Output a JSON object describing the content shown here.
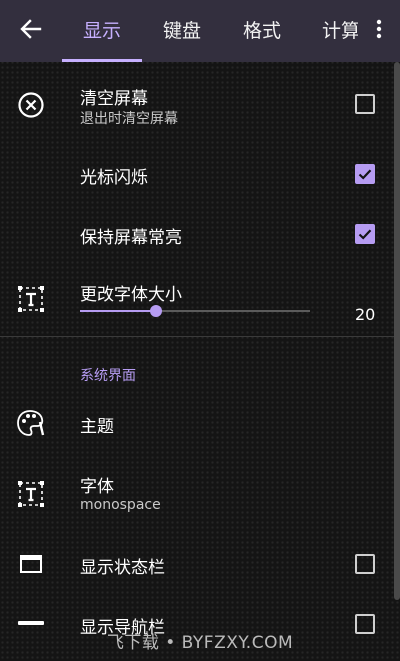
{
  "header": {
    "back_icon": "arrow-left-icon",
    "tabs": [
      {
        "label": "显示",
        "active": true
      },
      {
        "label": "键盘",
        "active": false
      },
      {
        "label": "格式",
        "active": false
      },
      {
        "label": "计算",
        "active": false
      }
    ],
    "overflow_icon": "more-vert-icon"
  },
  "settings": {
    "clear_screen": {
      "title": "清空屏幕",
      "subtitle": "退出时清空屏幕",
      "checked": false,
      "icon": "clear-circle-icon"
    },
    "cursor_blink": {
      "title": "光标闪烁",
      "checked": true
    },
    "keep_screen_on": {
      "title": "保持屏幕常亮",
      "checked": true
    },
    "font_size": {
      "title": "更改字体大小",
      "value": "20",
      "fraction": 0.33,
      "icon": "text-size-icon"
    }
  },
  "ui_section": {
    "title": "系统界面",
    "theme": {
      "title": "主题",
      "icon": "palette-icon"
    },
    "font": {
      "title": "字体",
      "subtitle": "monospace",
      "icon": "text-font-icon"
    },
    "status_bar": {
      "title": "显示状态栏",
      "checked": false,
      "icon": "window-icon"
    },
    "nav_bar": {
      "title": "显示导航栏",
      "checked": false,
      "icon": "minus-icon"
    }
  },
  "watermark": "飞下载 • BYFZXY.COM",
  "colors": {
    "accent": "#b69cf2",
    "toolbar": "#332f3e",
    "background": "#141414"
  }
}
